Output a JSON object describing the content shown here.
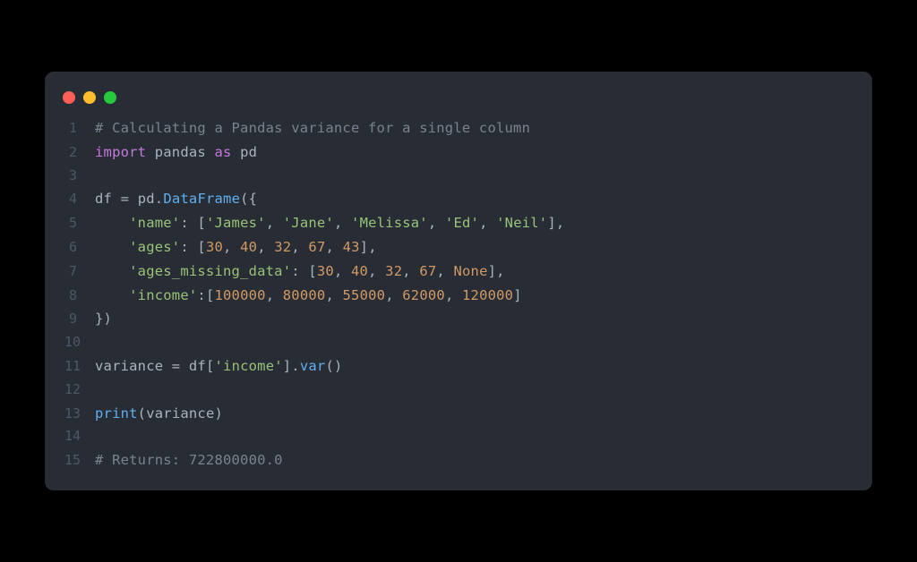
{
  "window": {
    "dots": [
      "red",
      "yellow",
      "green"
    ]
  },
  "code": {
    "lines": [
      {
        "n": "1",
        "tokens": [
          {
            "c": "tok-comment",
            "t": "# Calculating a Pandas variance for a single column"
          }
        ]
      },
      {
        "n": "2",
        "tokens": [
          {
            "c": "tok-keyword",
            "t": "import"
          },
          {
            "c": "tok-ident",
            "t": " pandas "
          },
          {
            "c": "tok-keyword",
            "t": "as"
          },
          {
            "c": "tok-ident",
            "t": " pd"
          }
        ]
      },
      {
        "n": "3",
        "tokens": [
          {
            "c": "tok-ident",
            "t": ""
          }
        ]
      },
      {
        "n": "4",
        "tokens": [
          {
            "c": "tok-ident",
            "t": "df "
          },
          {
            "c": "tok-punc",
            "t": "= "
          },
          {
            "c": "tok-ident",
            "t": "pd"
          },
          {
            "c": "tok-punc",
            "t": "."
          },
          {
            "c": "tok-func",
            "t": "DataFrame"
          },
          {
            "c": "tok-punc",
            "t": "({"
          }
        ]
      },
      {
        "n": "5",
        "tokens": [
          {
            "c": "tok-ident",
            "t": "    "
          },
          {
            "c": "tok-string",
            "t": "'name'"
          },
          {
            "c": "tok-punc",
            "t": ": ["
          },
          {
            "c": "tok-string",
            "t": "'James'"
          },
          {
            "c": "tok-punc",
            "t": ", "
          },
          {
            "c": "tok-string",
            "t": "'Jane'"
          },
          {
            "c": "tok-punc",
            "t": ", "
          },
          {
            "c": "tok-string",
            "t": "'Melissa'"
          },
          {
            "c": "tok-punc",
            "t": ", "
          },
          {
            "c": "tok-string",
            "t": "'Ed'"
          },
          {
            "c": "tok-punc",
            "t": ", "
          },
          {
            "c": "tok-string",
            "t": "'Neil'"
          },
          {
            "c": "tok-punc",
            "t": "],"
          }
        ]
      },
      {
        "n": "6",
        "tokens": [
          {
            "c": "tok-ident",
            "t": "    "
          },
          {
            "c": "tok-string",
            "t": "'ages'"
          },
          {
            "c": "tok-punc",
            "t": ": ["
          },
          {
            "c": "tok-number",
            "t": "30"
          },
          {
            "c": "tok-punc",
            "t": ", "
          },
          {
            "c": "tok-number",
            "t": "40"
          },
          {
            "c": "tok-punc",
            "t": ", "
          },
          {
            "c": "tok-number",
            "t": "32"
          },
          {
            "c": "tok-punc",
            "t": ", "
          },
          {
            "c": "tok-number",
            "t": "67"
          },
          {
            "c": "tok-punc",
            "t": ", "
          },
          {
            "c": "tok-number",
            "t": "43"
          },
          {
            "c": "tok-punc",
            "t": "],"
          }
        ]
      },
      {
        "n": "7",
        "tokens": [
          {
            "c": "tok-ident",
            "t": "    "
          },
          {
            "c": "tok-string",
            "t": "'ages_missing_data'"
          },
          {
            "c": "tok-punc",
            "t": ": ["
          },
          {
            "c": "tok-number",
            "t": "30"
          },
          {
            "c": "tok-punc",
            "t": ", "
          },
          {
            "c": "tok-number",
            "t": "40"
          },
          {
            "c": "tok-punc",
            "t": ", "
          },
          {
            "c": "tok-number",
            "t": "32"
          },
          {
            "c": "tok-punc",
            "t": ", "
          },
          {
            "c": "tok-number",
            "t": "67"
          },
          {
            "c": "tok-punc",
            "t": ", "
          },
          {
            "c": "tok-const",
            "t": "None"
          },
          {
            "c": "tok-punc",
            "t": "],"
          }
        ]
      },
      {
        "n": "8",
        "tokens": [
          {
            "c": "tok-ident",
            "t": "    "
          },
          {
            "c": "tok-string",
            "t": "'income'"
          },
          {
            "c": "tok-punc",
            "t": ":["
          },
          {
            "c": "tok-number",
            "t": "100000"
          },
          {
            "c": "tok-punc",
            "t": ", "
          },
          {
            "c": "tok-number",
            "t": "80000"
          },
          {
            "c": "tok-punc",
            "t": ", "
          },
          {
            "c": "tok-number",
            "t": "55000"
          },
          {
            "c": "tok-punc",
            "t": ", "
          },
          {
            "c": "tok-number",
            "t": "62000"
          },
          {
            "c": "tok-punc",
            "t": ", "
          },
          {
            "c": "tok-number",
            "t": "120000"
          },
          {
            "c": "tok-punc",
            "t": "]"
          }
        ]
      },
      {
        "n": "9",
        "tokens": [
          {
            "c": "tok-punc",
            "t": "})"
          }
        ]
      },
      {
        "n": "10",
        "tokens": [
          {
            "c": "tok-ident",
            "t": ""
          }
        ]
      },
      {
        "n": "11",
        "tokens": [
          {
            "c": "tok-ident",
            "t": "variance "
          },
          {
            "c": "tok-punc",
            "t": "= "
          },
          {
            "c": "tok-ident",
            "t": "df"
          },
          {
            "c": "tok-punc",
            "t": "["
          },
          {
            "c": "tok-string",
            "t": "'income'"
          },
          {
            "c": "tok-punc",
            "t": "]."
          },
          {
            "c": "tok-func",
            "t": "var"
          },
          {
            "c": "tok-punc",
            "t": "()"
          }
        ]
      },
      {
        "n": "12",
        "tokens": [
          {
            "c": "tok-ident",
            "t": ""
          }
        ]
      },
      {
        "n": "13",
        "tokens": [
          {
            "c": "tok-func",
            "t": "print"
          },
          {
            "c": "tok-punc",
            "t": "("
          },
          {
            "c": "tok-ident",
            "t": "variance"
          },
          {
            "c": "tok-punc",
            "t": ")"
          }
        ]
      },
      {
        "n": "14",
        "tokens": [
          {
            "c": "tok-ident",
            "t": ""
          }
        ]
      },
      {
        "n": "15",
        "tokens": [
          {
            "c": "tok-comment",
            "t": "# Returns: 722800000.0"
          }
        ]
      }
    ]
  }
}
